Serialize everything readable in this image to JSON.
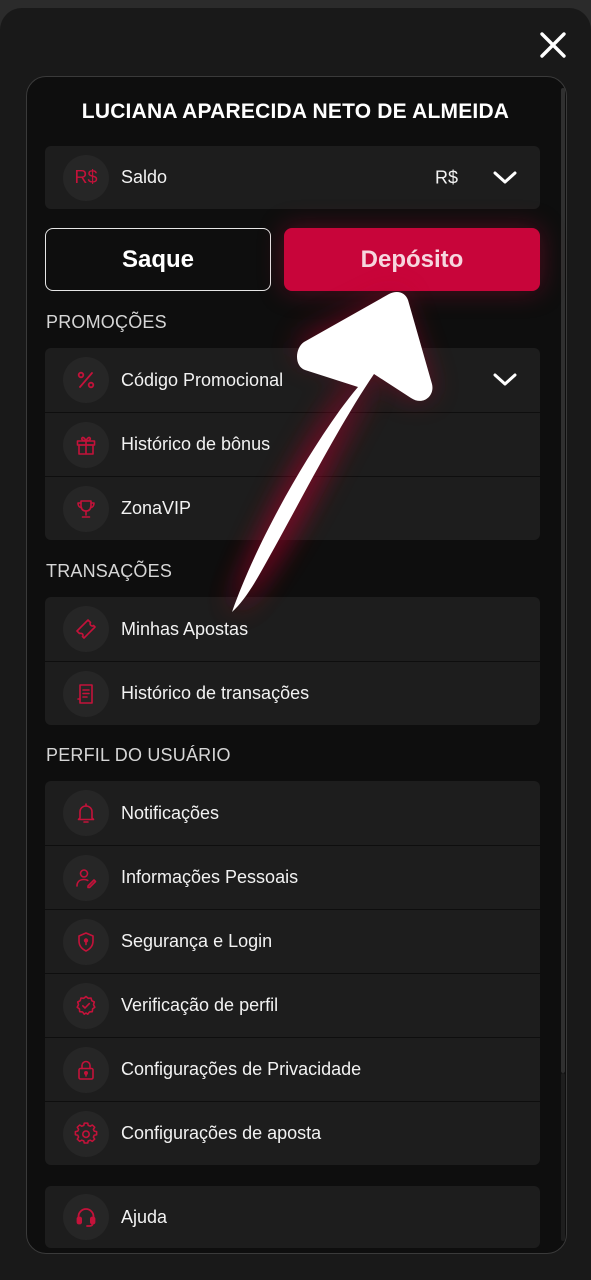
{
  "user": {
    "name": "LUCIANA APARECIDA NETO DE ALMEIDA"
  },
  "balance": {
    "icon_text": "R$",
    "label": "Saldo",
    "currency": "R$"
  },
  "buttons": {
    "withdraw": "Saque",
    "deposit": "Depósito"
  },
  "sections": {
    "promotions": {
      "title": "PROMOÇÕES",
      "items": [
        {
          "label": "Código Promocional",
          "icon": "percent-icon"
        },
        {
          "label": "Histórico de bônus",
          "icon": "gift-icon"
        },
        {
          "label": "ZonaVIP",
          "icon": "trophy-icon"
        }
      ]
    },
    "transactions": {
      "title": "TRANSAÇÕES",
      "items": [
        {
          "label": "Minhas Apostas",
          "icon": "ticket-icon"
        },
        {
          "label": "Histórico de transações",
          "icon": "receipt-icon"
        }
      ]
    },
    "profile": {
      "title": "PERFIL DO USUÁRIO",
      "items": [
        {
          "label": "Notificações",
          "icon": "bell-icon"
        },
        {
          "label": "Informações Pessoais",
          "icon": "user-edit-icon"
        },
        {
          "label": "Segurança e Login",
          "icon": "shield-icon"
        },
        {
          "label": "Verificação de perfil",
          "icon": "verified-badge-icon"
        },
        {
          "label": "Configurações de Privacidade",
          "icon": "lock-icon"
        },
        {
          "label": "Configurações de aposta",
          "icon": "gear-icon"
        }
      ]
    },
    "help": {
      "items": [
        {
          "label": "Ajuda",
          "icon": "headset-icon"
        }
      ]
    }
  },
  "colors": {
    "accent": "#c8053a",
    "icon_red": "#c4123a",
    "panel": "#0e0e0e",
    "card": "#1d1d1d"
  }
}
